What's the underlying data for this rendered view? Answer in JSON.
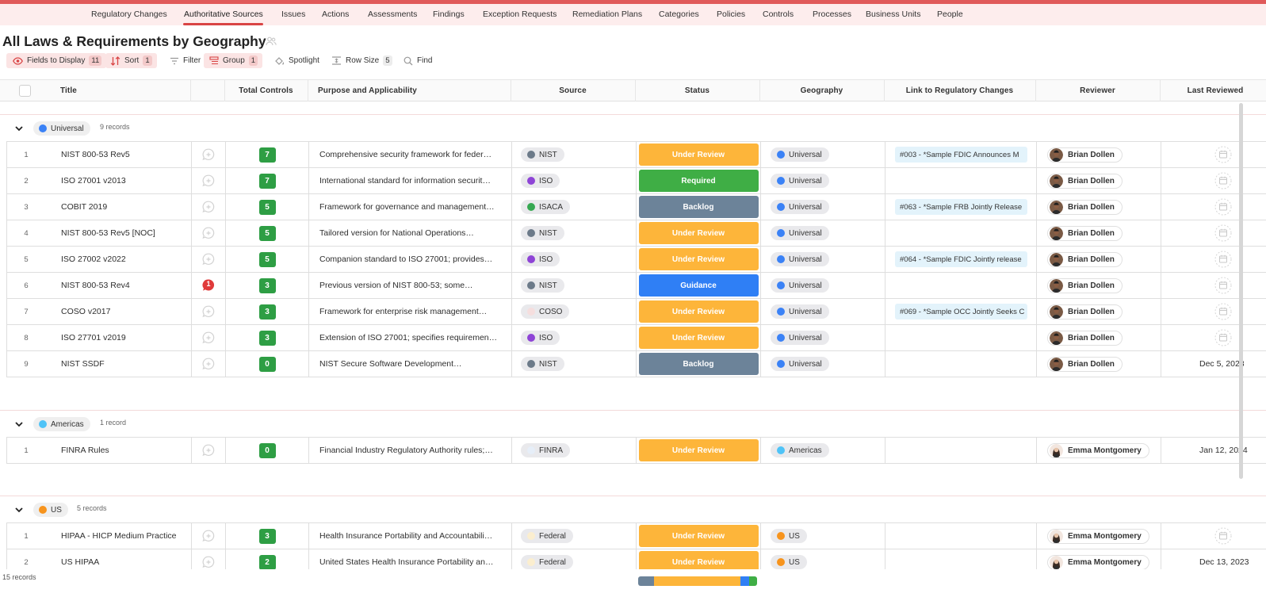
{
  "nav": {
    "items": [
      "Regulatory Changes",
      "Authoritative Sources",
      "Issues",
      "Actions",
      "Assessments",
      "Findings",
      "Exception Requests",
      "Remediation Plans",
      "Categories",
      "Policies",
      "Controls",
      "Processes",
      "Business Units",
      "People"
    ],
    "active": "Authoritative Sources"
  },
  "page": {
    "title": "All Laws & Requirements by Geography"
  },
  "toolbar": {
    "fields_label": "Fields to Display",
    "fields_count": "11",
    "sort_label": "Sort",
    "sort_count": "1",
    "filter_label": "Filter",
    "group_label": "Group",
    "group_count": "1",
    "spotlight_label": "Spotlight",
    "rowsize_label": "Row Size",
    "rowsize_count": "5",
    "find_label": "Find"
  },
  "columns": [
    "Title",
    "Total Controls",
    "Purpose and Applicability",
    "Source",
    "Status",
    "Geography",
    "Link to Regulatory Changes",
    "Reviewer",
    "Last Reviewed"
  ],
  "colors": {
    "accent": "#d94444",
    "status": {
      "Under Review": "#fdb53a",
      "Required": "#3fae45",
      "Backlog": "#6c8399",
      "Guidance": "#2f7ff5"
    },
    "sources": {
      "NIST": "#6c7a89",
      "ISO": "#8e44d6",
      "ISACA": "#36a852",
      "COSO": "#f5dede",
      "FINRA": "#e6eef8",
      "Federal": "#fbeecf"
    },
    "geo": {
      "Universal": "#3b82f6",
      "Americas": "#4fc3f7",
      "US": "#f7941d"
    }
  },
  "groups": [
    {
      "name": "Universal",
      "count_label": "9 records",
      "rows": [
        {
          "n": "1",
          "title": "NIST 800-53 Rev5",
          "comments": "",
          "controls": "7",
          "purpose": "Comprehensive security framework for feder…",
          "source": "NIST",
          "status": "Under Review",
          "geo": "Universal",
          "link": "#003 - *Sample FDIC Announces M",
          "reviewer": "Brian Dollen",
          "date": ""
        },
        {
          "n": "2",
          "title": "ISO 27001 v2013",
          "comments": "",
          "controls": "7",
          "purpose": "International standard for information securit…",
          "source": "ISO",
          "status": "Required",
          "geo": "Universal",
          "link": "",
          "reviewer": "Brian Dollen",
          "date": ""
        },
        {
          "n": "3",
          "title": "COBIT 2019",
          "comments": "",
          "controls": "5",
          "purpose": "Framework for governance and management…",
          "source": "ISACA",
          "status": "Backlog",
          "geo": "Universal",
          "link": "#063 - *Sample FRB Jointly Release",
          "reviewer": "Brian Dollen",
          "date": ""
        },
        {
          "n": "4",
          "title": "NIST 800-53 Rev5 [NOC]",
          "comments": "",
          "controls": "5",
          "purpose": "Tailored version for National Operations…",
          "source": "NIST",
          "status": "Under Review",
          "geo": "Universal",
          "link": "",
          "reviewer": "Brian Dollen",
          "date": ""
        },
        {
          "n": "5",
          "title": "ISO 27002 v2022",
          "comments": "",
          "controls": "5",
          "purpose": "Companion standard to ISO 27001; provides…",
          "source": "ISO",
          "status": "Under Review",
          "geo": "Universal",
          "link": "#064 - *Sample FDIC Jointly release",
          "reviewer": "Brian Dollen",
          "date": ""
        },
        {
          "n": "6",
          "title": "NIST 800-53 Rev4",
          "comments": "1",
          "controls": "3",
          "purpose": "Previous version of NIST 800-53; some…",
          "source": "NIST",
          "status": "Guidance",
          "geo": "Universal",
          "link": "",
          "reviewer": "Brian Dollen",
          "date": ""
        },
        {
          "n": "7",
          "title": "COSO v2017",
          "comments": "",
          "controls": "3",
          "purpose": "Framework for enterprise risk management…",
          "source": "COSO",
          "status": "Under Review",
          "geo": "Universal",
          "link": "#069 - *Sample OCC Jointly Seeks C",
          "reviewer": "Brian Dollen",
          "date": ""
        },
        {
          "n": "8",
          "title": "ISO 27701 v2019",
          "comments": "",
          "controls": "3",
          "purpose": "Extension of ISO 27001; specifies requiremen…",
          "source": "ISO",
          "status": "Under Review",
          "geo": "Universal",
          "link": "",
          "reviewer": "Brian Dollen",
          "date": ""
        },
        {
          "n": "9",
          "title": "NIST SSDF",
          "comments": "",
          "controls": "0",
          "purpose": "NIST Secure Software Development…",
          "source": "NIST",
          "status": "Backlog",
          "geo": "Universal",
          "link": "",
          "reviewer": "Brian Dollen",
          "date": "Dec 5, 2023"
        }
      ]
    },
    {
      "name": "Americas",
      "count_label": "1 record",
      "rows": [
        {
          "n": "1",
          "title": "FINRA Rules",
          "comments": "",
          "controls": "0",
          "purpose": "Financial Industry Regulatory Authority rules;…",
          "source": "FINRA",
          "status": "Under Review",
          "geo": "Americas",
          "link": "",
          "reviewer": "Emma Montgomery",
          "date": "Jan 12, 2024"
        }
      ]
    },
    {
      "name": "US",
      "count_label": "5 records",
      "rows": [
        {
          "n": "1",
          "title": "HIPAA - HICP Medium Practice",
          "comments": "",
          "controls": "3",
          "purpose": "Health Insurance Portability and Accountabili…",
          "source": "Federal",
          "status": "Under Review",
          "geo": "US",
          "link": "",
          "reviewer": "Emma Montgomery",
          "date": ""
        },
        {
          "n": "2",
          "title": "US HIPAA",
          "comments": "",
          "controls": "2",
          "purpose": "United States Health Insurance Portability an…",
          "source": "Federal",
          "status": "Under Review",
          "geo": "US",
          "link": "",
          "reviewer": "Emma Montgomery",
          "date": "Dec 13, 2023"
        }
      ]
    }
  ],
  "footer": {
    "records_label": "15 records"
  },
  "status_summary": [
    {
      "status": "Backlog",
      "fraction": 0.13
    },
    {
      "status": "Under Review",
      "fraction": 0.73
    },
    {
      "status": "Guidance",
      "fraction": 0.07
    },
    {
      "status": "Required",
      "fraction": 0.07
    }
  ]
}
